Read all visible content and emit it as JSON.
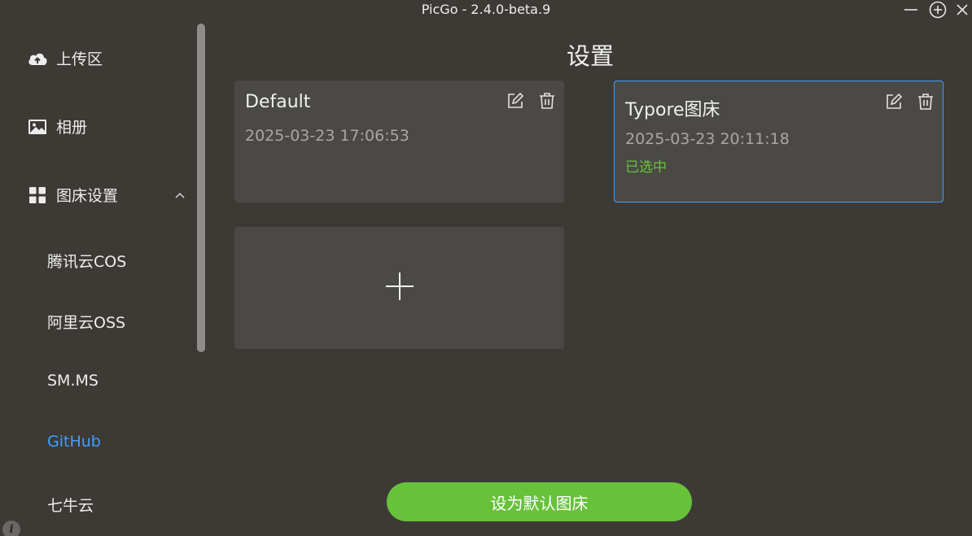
{
  "window": {
    "title": "PicGo - 2.4.0-beta.9",
    "controls": [
      "minimize-icon",
      "plus-circle-icon",
      "close-icon"
    ]
  },
  "sidebar": {
    "items": [
      {
        "label": "上传区",
        "icon": "cloud-upload-icon"
      },
      {
        "label": "相册",
        "icon": "image-icon"
      },
      {
        "label": "图床设置",
        "icon": "grid-icon",
        "expanded": true
      }
    ],
    "sub_items": [
      {
        "label": "腾讯云COS"
      },
      {
        "label": "阿里云OSS"
      },
      {
        "label": "SM.MS"
      },
      {
        "label": "GitHub",
        "active": true
      },
      {
        "label": "七牛云"
      }
    ]
  },
  "main": {
    "title": "设置",
    "configs": [
      {
        "name": "Default",
        "time": "2025-03-23 17:06:53",
        "status": ""
      },
      {
        "name": "Typore图床",
        "time": "2025-03-23 20:11:18",
        "status": "已选中",
        "selected": true
      }
    ],
    "set_default_label": "设为默认图床"
  },
  "colors": {
    "background": "#3d3a36",
    "card": "#4b4946",
    "accent_blue": "#409eff",
    "accent_green": "#67c23a"
  }
}
